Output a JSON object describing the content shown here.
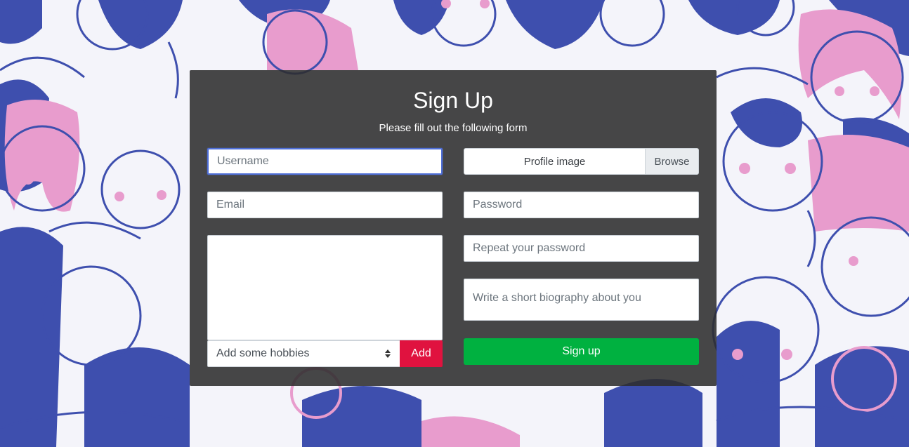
{
  "form": {
    "title": "Sign Up",
    "subtitle": "Please fill out the following form",
    "username_placeholder": "Username",
    "email_placeholder": "Email",
    "hobbies_list_value": "",
    "hobby_select_label": "Add some hobbies",
    "add_label": "Add",
    "profile_image_label": "Profile image",
    "browse_label": "Browse",
    "password_placeholder": "Password",
    "repeat_password_placeholder": "Repeat your password",
    "bio_placeholder": "Write a short biography about you",
    "signup_label": "Sign up"
  },
  "colors": {
    "panel": "#2d2d2d",
    "add_button": "#e0123f",
    "signup_button": "#00b140",
    "illustration_blue": "#3e4fae",
    "illustration_pink": "#e89ccd"
  },
  "background": {
    "icon": "crowd-illustration"
  }
}
